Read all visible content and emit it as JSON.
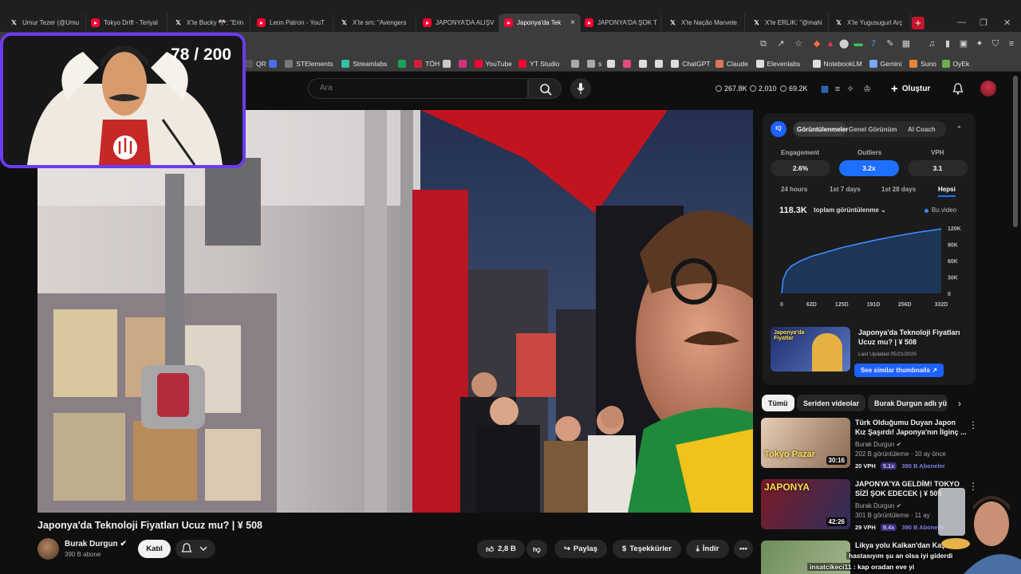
{
  "browser": {
    "tabs": [
      {
        "label": "Umur Tezer (@Umu",
        "icon": "x"
      },
      {
        "label": "Tokyo Drift - Teriyal",
        "icon": "yt"
      },
      {
        "label": "X'te Bucky 🎌: \"Erin",
        "icon": "x"
      },
      {
        "label": "Leon Patron - YouT",
        "icon": "yt"
      },
      {
        "label": "X'te sm: \"Avengers",
        "icon": "x"
      },
      {
        "label": "JAPONYA'DA ALIŞV",
        "icon": "yt"
      },
      {
        "label": "Japonya'da Tek",
        "icon": "yt",
        "active": true
      },
      {
        "label": "JAPONYA'DA ŞOK T",
        "icon": "yt"
      },
      {
        "label": "X'te Nação Marvete",
        "icon": "x"
      },
      {
        "label": "X'te ERLIK: \"@mahi",
        "icon": "x"
      },
      {
        "label": "X'te Yugusugurl Arç",
        "icon": "x"
      }
    ],
    "new_tab": "+",
    "close_tab": "×",
    "window_controls": [
      "—",
      "❐",
      "✕"
    ],
    "bookmarks": [
      {
        "label": "QR",
        "color": "#555555"
      },
      {
        "label": "",
        "color": "#4a6ee0"
      },
      {
        "label": "STElements",
        "color": "#777777"
      },
      {
        "label": "Streamlabs",
        "color": "#31c3a2"
      },
      {
        "label": "",
        "color": "#18a15a"
      },
      {
        "label": "TÖH",
        "color": "#d0203a"
      },
      {
        "label": "",
        "color": "#cccccc"
      },
      {
        "label": "",
        "color": "#d6307d"
      },
      {
        "label": "YouTube",
        "color": "#ff0033"
      },
      {
        "label": "YT Studio",
        "color": "#ff0033"
      },
      {
        "label": "",
        "color": "#aaaaaa"
      },
      {
        "label": "s",
        "color": "#aaaaaa"
      },
      {
        "label": "",
        "color": "#dddddd"
      },
      {
        "label": "",
        "color": "#e24b7a"
      },
      {
        "label": "",
        "color": "#dddddd"
      },
      {
        "label": "",
        "color": "#dddddd"
      },
      {
        "label": "ChatGPT",
        "color": "#dddddd"
      },
      {
        "label": "Claude",
        "color": "#d97757"
      },
      {
        "label": "Elevenlabs",
        "color": "#dddddd"
      },
      {
        "label": "NotebookLM",
        "color": "#dddddd"
      },
      {
        "label": "Gemini",
        "color": "#7aa7f7"
      },
      {
        "label": "Suno",
        "color": "#e8843a"
      },
      {
        "label": "OyEk",
        "color": "#6ab04c"
      }
    ]
  },
  "header": {
    "search_placeholder": "Ara",
    "stats": [
      "267.8K",
      "2,010",
      "69.2K"
    ],
    "create_label": "Oluştur"
  },
  "overlay": {
    "counter": "78 / 200"
  },
  "vidiq": {
    "tabs": [
      "Görüntülenmeler",
      "Genel Görünüm",
      "AI Coach"
    ],
    "metric_labels": [
      "Engagement",
      "Outliers",
      "VPH"
    ],
    "metric_values": [
      "2.6%",
      "3.2x",
      "3.1"
    ],
    "ranges": [
      "24 hours",
      "1st 7 days",
      "1st 28 days",
      "Hepsi"
    ],
    "total_views": "118.3K",
    "total_label": "toplam görüntülenme ⌄",
    "legend": "Bu video",
    "related_title": "Japonya'da Teknoloji Fiyatları Ucuz mu? | ¥ 508",
    "last_updated": "Last Updated 05/21/2025",
    "similar_button": "See similar thumbnails ↗",
    "thumb_caption": "Japonya'da Fiyatlar"
  },
  "chart_data": {
    "type": "area",
    "x_ticks": [
      "0",
      "62D",
      "125D",
      "191D",
      "256D",
      "332D"
    ],
    "y_ticks": [
      "120K",
      "90K",
      "60K",
      "30K",
      "0"
    ],
    "ylim": [
      0,
      120000
    ],
    "xlim": [
      0,
      332
    ],
    "series": [
      {
        "name": "Bu video",
        "x": [
          0,
          3,
          10,
          20,
          40,
          62,
          90,
          125,
          160,
          191,
          225,
          256,
          290,
          332
        ],
        "values": [
          0,
          25000,
          40000,
          50000,
          60000,
          68000,
          75000,
          84000,
          91000,
          97000,
          103000,
          108000,
          113000,
          118300
        ]
      }
    ],
    "colors": {
      "line": "#3d8bff",
      "fill": "#1f4a86"
    }
  },
  "chips": [
    "Tümü",
    "Seriden videolar",
    "Burak Durgun adlı yü"
  ],
  "recommendations": [
    {
      "title": "Türk Olduğumu Duyan Japon Kız Şaşırdı! Japonya'nın İlginç ...",
      "channel": "Burak Durgun ✔",
      "meta": "202 B görüntüleme · 10 ay önce",
      "vph": "20 VPH",
      "multiplier": "5.1x",
      "subs": "390 B Aboneler",
      "duration": "30:16",
      "thumb_text": "Tokyo Pazar"
    },
    {
      "title": "JAPONYA'YA GELDİM! TOKYO SİZİ ŞOK EDECEK | ¥ 505",
      "channel": "Burak Durgun ✔",
      "meta": "301 B görüntüleme · 11 ay",
      "vph": "29 VPH",
      "multiplier": "9.4x",
      "subs": "390 B Aboneler",
      "duration": "42:26",
      "thumb_text": "JAPONYA"
    },
    {
      "title": "Likya yolu Kalkan'dan Kaş'a",
      "channel": "",
      "meta": "",
      "vph": "",
      "multiplier": "",
      "subs": "",
      "duration": "",
      "thumb_text": ""
    }
  ],
  "video": {
    "title": "Japonya'da Teknoloji Fiyatları Ucuz mu? | ¥ 508",
    "channel": "Burak Durgun ✔",
    "subs": "390 B abone",
    "join": "Katıl",
    "likes": "2,8 B",
    "share": "Paylaş",
    "thanks": "Teşekkürler",
    "download": "İndir",
    "more": "•••"
  },
  "chat": [
    {
      "text": "hastasıyım şu an olsa iyi giderdi"
    },
    {
      "text": "insatcikeci11 : kap oradan eve yi"
    }
  ]
}
